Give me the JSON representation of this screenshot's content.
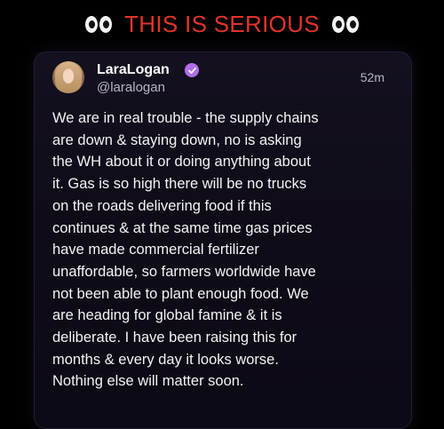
{
  "banner": {
    "title": "THIS IS SERIOUS"
  },
  "post": {
    "display_name": "LaraLogan",
    "handle": "@laralogan",
    "time": "52m",
    "text": "We are in real trouble - the supply chains\nare down & staying down, no is asking\nthe WH about it or doing anything about\nit. Gas is so high there will be no trucks\non the roads delivering food if this\ncontinues & at the same time gas prices\nhave made commercial fertilizer\nunaffordable, so farmers worldwide have\nnot been able to plant enough food. We\nare heading for global famine & it is\ndeliberate. I have been raising this for\nmonths & every day it looks worse.\nNothing else will matter soon."
  },
  "icons": {
    "left_eyes": "eyes-icon",
    "right_eyes": "eyes-icon",
    "verified": "verified-badge-icon",
    "avatar": "profile-avatar"
  },
  "colors": {
    "banner_text": "#e1342a",
    "verified_badge": "#b06ee8",
    "card_background": "#120f1c"
  }
}
